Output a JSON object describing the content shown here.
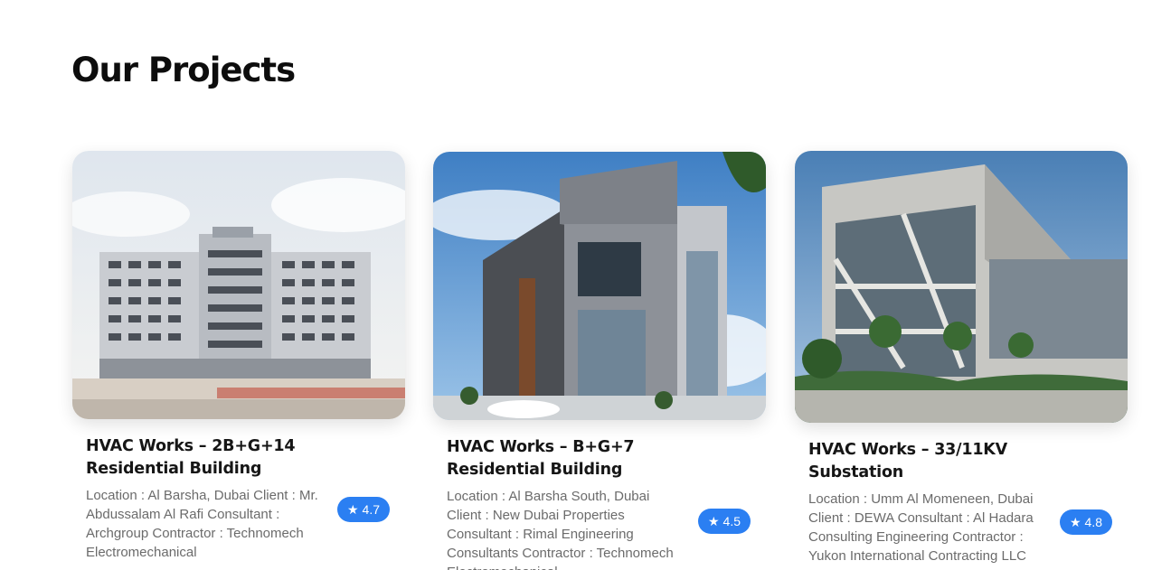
{
  "section": {
    "title": "Our Projects"
  },
  "projects": [
    {
      "title": "HVAC Works – 2B+G+14 Residential Building",
      "description": "Location : Al Barsha, Dubai Client : Mr. Abdussalam Al Rafi Consultant : Archgroup Contractor : Technomech Electromechanical",
      "rating": "4.7",
      "icon": "star-icon"
    },
    {
      "title": "HVAC Works – B+G+7 Residential Building",
      "description": "Location : Al Barsha South, Dubai Client : New Dubai Properties Consultant : Rimal Engineering Consultants Contractor : Technomech Electromechanical",
      "rating": "4.5",
      "icon": "star-icon"
    },
    {
      "title": "HVAC Works – 33/11KV Substation",
      "description": "Location : Umm Al Momeneen, Dubai Client : DEWA Consultant : Al Hadara Consulting Engineering Contractor : Yukon International Contracting LLC",
      "rating": "4.8",
      "icon": "star-icon"
    }
  ],
  "colors": {
    "accent": "#2b7ff2",
    "title": "#0d0d0d",
    "text": "#6b6b6b"
  }
}
